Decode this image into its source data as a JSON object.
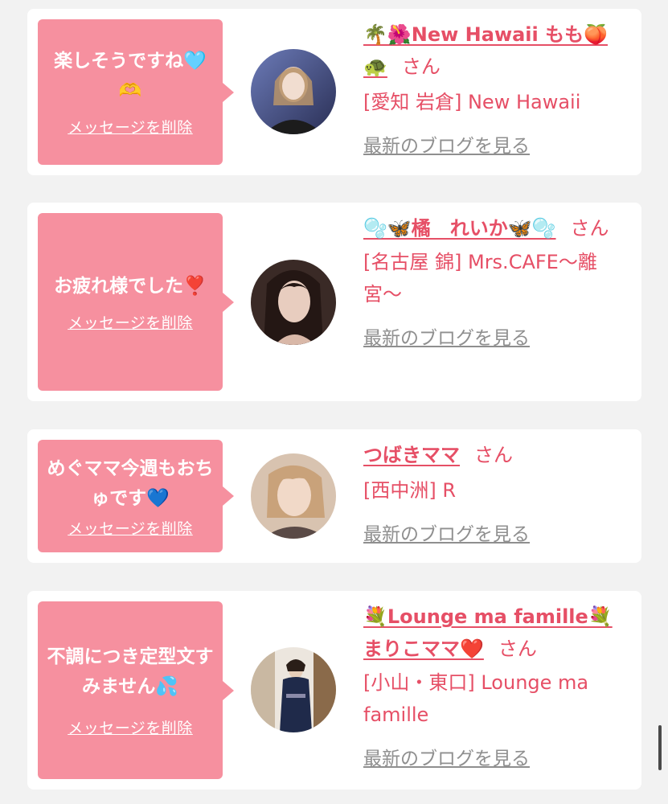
{
  "entries": [
    {
      "message": "楽しそうですね🩵🫶",
      "delete_label": "メッセージを削除",
      "name": "🌴🌺New Hawaii もも🍑🐢",
      "san": "さん",
      "shop": "[愛知 岩倉] New Hawaii",
      "blog_label": "最新のブログを見る"
    },
    {
      "message": "お疲れ様でした❣️",
      "delete_label": "メッセージを削除",
      "name": "🫧🦋橘　れいか🦋🫧",
      "san": "さん",
      "shop": "[名古屋 錦] Mrs.CAFE〜離宮〜",
      "blog_label": "最新のブログを見る"
    },
    {
      "message": "めぐママ今週もおちゅです💙",
      "delete_label": "メッセージを削除",
      "name": "つばきママ",
      "san": "さん",
      "shop": "[西中洲] R",
      "blog_label": "最新のブログを見る"
    },
    {
      "message": "不調につき定型文すみません💦",
      "delete_label": "メッセージを削除",
      "name": "💐Lounge ma famille💐まりこママ❤️",
      "san": "さん",
      "shop": "[小山・東口] Lounge ma famille",
      "blog_label": "最新のブログを見る"
    }
  ],
  "colors": {
    "accent": "#e64f66",
    "bubble": "#f6909f",
    "card": "#ffffff",
    "background": "#f2f2f2",
    "link_gray": "#8f8f8f"
  }
}
